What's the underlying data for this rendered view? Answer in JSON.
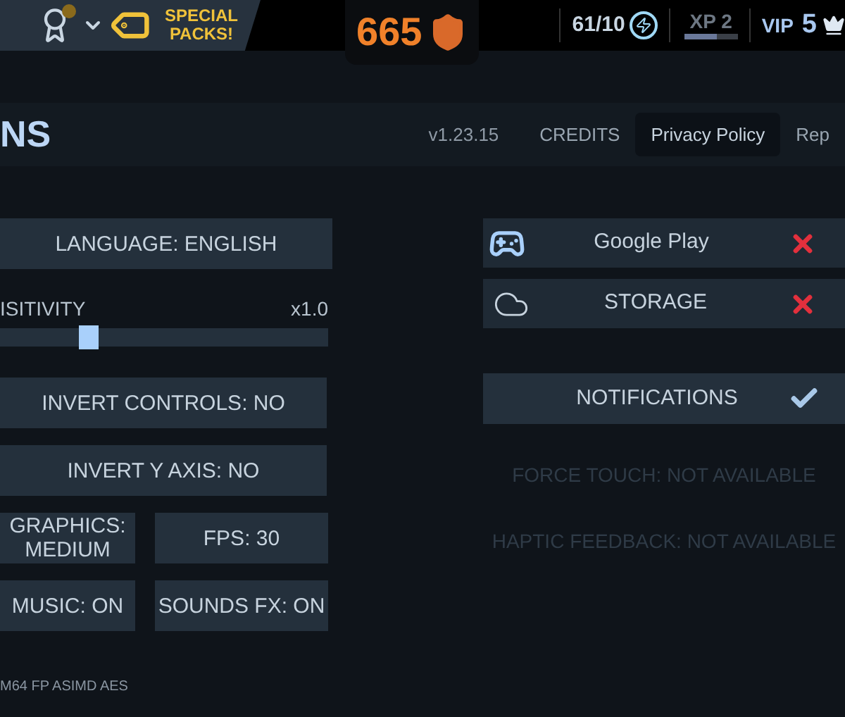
{
  "top_bar": {
    "medal_alert": true,
    "promo": "SPECIAL PACKS!",
    "currency": "665",
    "energy": "61/10",
    "xp": {
      "label": "XP 2",
      "level": 0.62
    },
    "vip": {
      "label": "VIP",
      "value": "5"
    }
  },
  "header": {
    "title": "NS",
    "version": "v1.23.15",
    "links": [
      {
        "label": "CREDITS",
        "selected": false
      },
      {
        "label": "Privacy Policy",
        "selected": true
      },
      {
        "label": "Rep",
        "selected": false
      }
    ]
  },
  "left_settings": [
    {
      "kind": "button",
      "label": "LANGUAGE: ENGLISH"
    },
    {
      "kind": "slider",
      "label": "ISITIVITY",
      "reading": "x1.0",
      "level": 0.27
    },
    {
      "kind": "button",
      "label": "INVERT CONTROLS: NO"
    },
    {
      "kind": "button",
      "label": "INVERT Y AXIS: NO"
    },
    {
      "kind": "pair",
      "items": [
        "GRAPHICS: MEDIUM",
        "FPS: 30"
      ]
    },
    {
      "kind": "pair",
      "items": [
        "MUSIC: ON",
        "SOUNDS FX: ON"
      ]
    }
  ],
  "accounts": [
    {
      "kind": "gamepad",
      "label": "Google Play",
      "connected": false
    },
    {
      "kind": "cloud",
      "label": "STORAGE",
      "connected": false
    }
  ],
  "notifications": {
    "label": "NOTIFICATIONS",
    "on": true
  },
  "unavailable": [
    "FORCE TOUCH: NOT AVAILABLE",
    "HAPTIC FEEDBACK: NOT AVAILABLE"
  ],
  "footer": "M64 FP ASIMD AES"
}
